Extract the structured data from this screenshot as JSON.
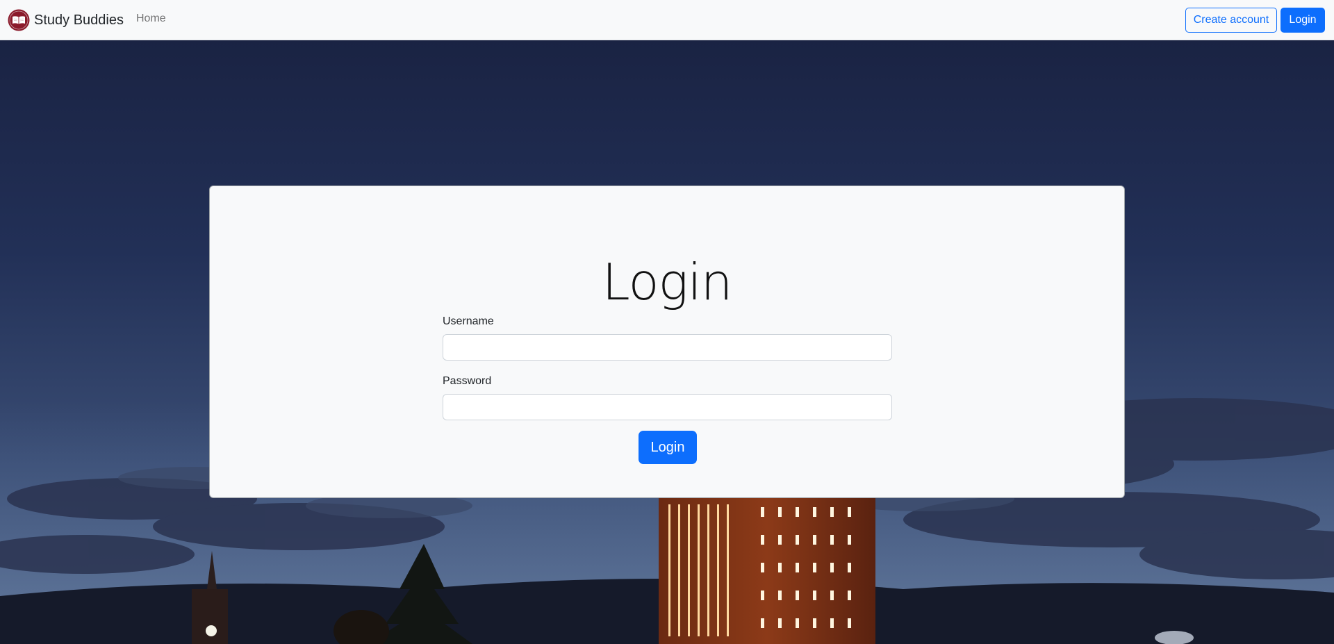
{
  "navbar": {
    "brand_name": "Study Buddies",
    "home_link": "Home",
    "create_account_label": "Create account",
    "login_label": "Login",
    "logo_icon": "book-logo-icon",
    "logo_color": "#8b1a2b"
  },
  "login_form": {
    "title": "Login",
    "username_label": "Username",
    "username_value": "",
    "password_label": "Password",
    "password_value": "",
    "submit_label": "Login"
  },
  "colors": {
    "primary": "#0d6efd",
    "navbar_bg": "#f8f9fa",
    "card_bg": "#f8f9fa",
    "sky_top": "#1b2544",
    "sky_bottom": "#47597d"
  }
}
